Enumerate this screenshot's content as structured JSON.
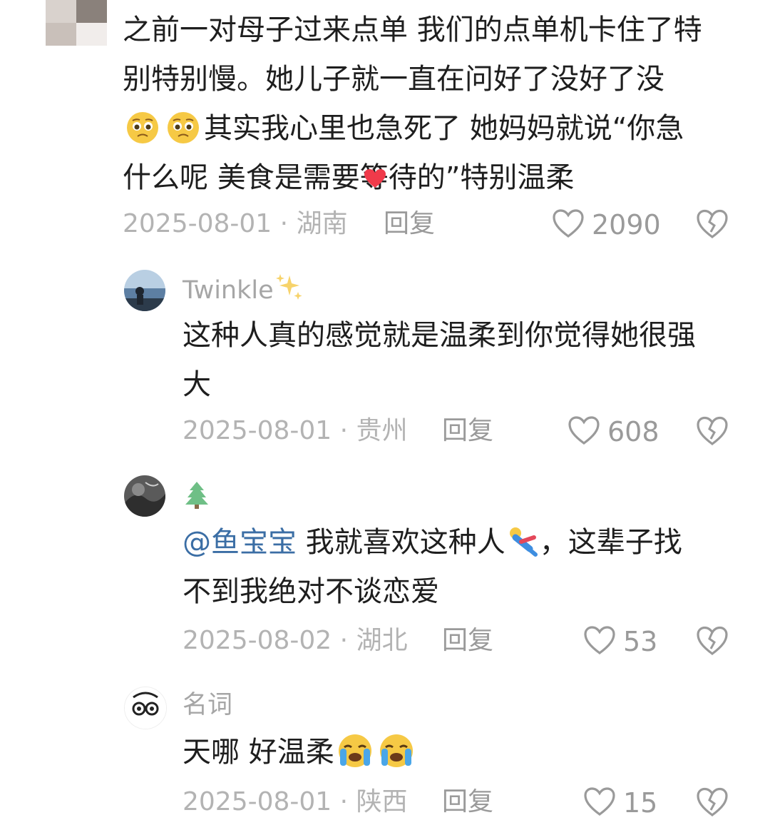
{
  "comments": [
    {
      "username": "",
      "lines": [
        "之前一对母子过来点单 我们的点单机卡住了特",
        "别特别慢。她儿子就一直在问好了没好了没",
        "其实我心里也急死了 她妈妈就说“你急",
        "什么呢 美食是需要等待的”特别温柔"
      ],
      "date": "2025-08-01",
      "location": "湖南",
      "reply_label": "回复",
      "likes": "2090"
    },
    {
      "username": "Twinkle",
      "lines": [
        "这种人真的感觉就是温柔到你觉得她很强",
        "大"
      ],
      "date": "2025-08-01",
      "location": "贵州",
      "reply_label": "回复",
      "likes": "608"
    },
    {
      "username": "",
      "mention": "@鱼宝宝",
      "lines": [
        "我就喜欢这种人",
        "，这辈子找",
        "不到我绝对不谈恋爱"
      ],
      "date": "2025-08-02",
      "location": "湖北",
      "reply_label": "回复",
      "likes": "53"
    },
    {
      "username": "名词",
      "lines": [
        "天哪 好温柔"
      ],
      "date": "2025-08-01",
      "location": "陕西",
      "reply_label": "回复",
      "likes": "15"
    }
  ],
  "separator": "·",
  "icons": {
    "like": "heart-outline-icon",
    "dislike": "broken-heart-icon",
    "sparkle": "sparkles-icon",
    "tree": "evergreen-tree-icon"
  },
  "colors": {
    "text": "#1e1e1e",
    "meta": "#b3b3b3",
    "mention": "#3b6ea5",
    "icon": "#9a9a9a"
  }
}
